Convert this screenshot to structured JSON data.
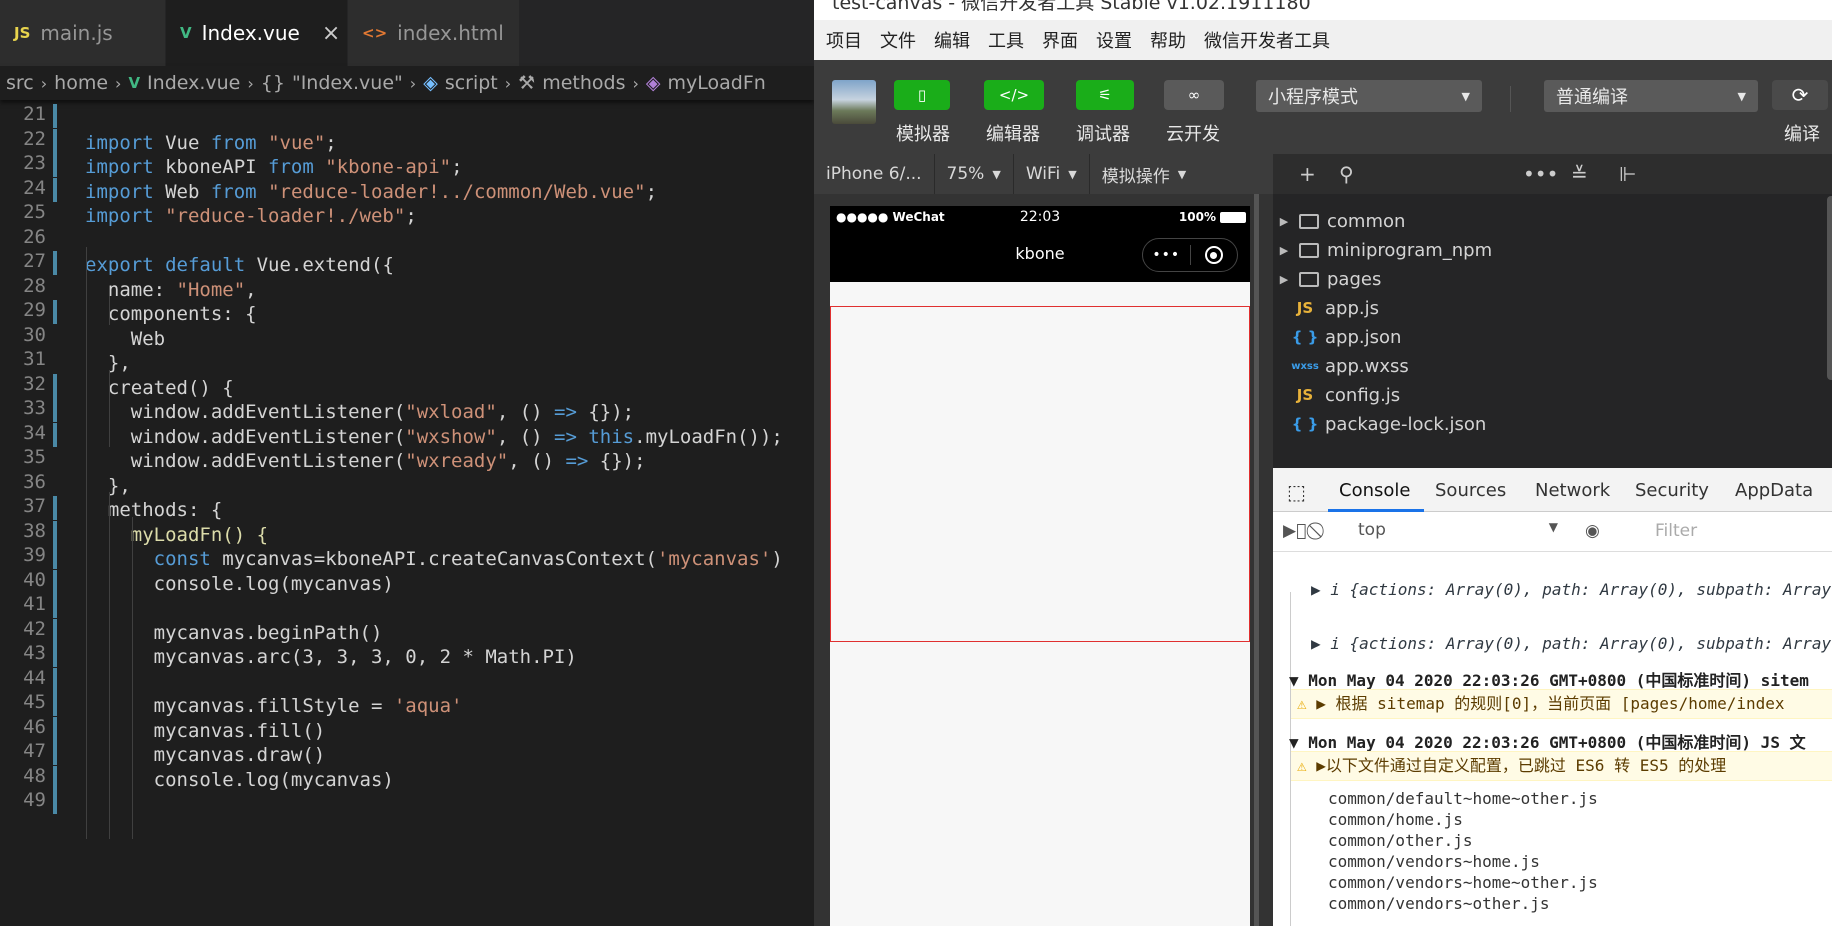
{
  "editor": {
    "tabs": [
      {
        "icon": "JS",
        "label": "main.js"
      },
      {
        "icon": "V",
        "label": "Index.vue",
        "close": "×"
      },
      {
        "icon": "<>",
        "label": "index.html"
      }
    ],
    "breadcrumb": {
      "src": "src",
      "home": "home",
      "file": "Index.vue",
      "obj": "\"Index.vue\"",
      "script": "script",
      "methods": "methods",
      "fn": "myLoadFn"
    },
    "lines": [
      {
        "n": "21"
      },
      {
        "n": "22"
      },
      {
        "n": "23"
      },
      {
        "n": "24"
      },
      {
        "n": "25"
      },
      {
        "n": "26"
      },
      {
        "n": "27"
      },
      {
        "n": "28"
      },
      {
        "n": "29"
      },
      {
        "n": "30"
      },
      {
        "n": "31"
      },
      {
        "n": "32"
      },
      {
        "n": "33"
      },
      {
        "n": "34"
      },
      {
        "n": "35"
      },
      {
        "n": "36"
      },
      {
        "n": "37"
      },
      {
        "n": "38"
      },
      {
        "n": "39"
      },
      {
        "n": "40"
      },
      {
        "n": "41"
      },
      {
        "n": "42"
      },
      {
        "n": "43"
      },
      {
        "n": "44"
      },
      {
        "n": "45"
      },
      {
        "n": "46"
      },
      {
        "n": "47"
      },
      {
        "n": "48"
      },
      {
        "n": "49"
      }
    ],
    "code": {
      "l21": [
        "import",
        " Vue ",
        "from",
        " ",
        "\"vue\"",
        ";"
      ],
      "l22": [
        "import",
        " kboneAPI ",
        "from",
        " ",
        "\"kbone-api\"",
        ";"
      ],
      "l23": [
        "import",
        " Web ",
        "from",
        " ",
        "\"reduce-loader!../common/Web.vue\"",
        ";"
      ],
      "l24": [
        "import",
        " ",
        "\"reduce-loader!./web\"",
        ";"
      ],
      "l26": [
        "export",
        " ",
        "default",
        " Vue.extend({"
      ],
      "l27": [
        "  name: ",
        "\"Home\"",
        ","
      ],
      "l28": [
        "  components: {"
      ],
      "l29": [
        "    Web"
      ],
      "l30": [
        "  },"
      ],
      "l31": [
        "  created() {"
      ],
      "l32": [
        "    window.addEventListener(",
        "\"wxload\"",
        ", () ",
        "=>",
        " {});"
      ],
      "l33": [
        "    window.addEventListener(",
        "\"wxshow\"",
        ", () ",
        "=>",
        " ",
        "this",
        ".myLoadFn());"
      ],
      "l34": [
        "    window.addEventListener(",
        "\"wxready\"",
        ", () ",
        "=>",
        " {});"
      ],
      "l35": [
        "  },"
      ],
      "l36": [
        "  methods: {"
      ],
      "l37": [
        "    myLoadFn() {"
      ],
      "l38": [
        "      ",
        "const",
        " mycanvas=kboneAPI.createCanvasContext(",
        "'mycanvas'",
        ")"
      ],
      "l39": [
        "      console.log(mycanvas)"
      ],
      "l41": [
        "      mycanvas.beginPath()"
      ],
      "l42": [
        "      mycanvas.arc(3, 3, 3, 0, 2 * Math.PI)"
      ],
      "l44": [
        "      mycanvas.fillStyle = ",
        "'aqua'"
      ],
      "l45": [
        "      mycanvas.fill()"
      ],
      "l46": [
        "      mycanvas.draw()"
      ],
      "l47": [
        "      console.log(mycanvas)"
      ]
    }
  },
  "devtools": {
    "title": "test-canvas - 微信开发者工具 Stable v1.02.1911180",
    "menu": [
      "项目",
      "文件",
      "编辑",
      "工具",
      "界面",
      "设置",
      "帮助",
      "微信开发者工具"
    ],
    "toolbar": {
      "simulator": "模拟器",
      "editor": "编辑器",
      "debugger": "调试器",
      "cloud": "云开发",
      "mode": "小程序模式",
      "compile_mode": "普通编译",
      "compile": "编译"
    },
    "devicebar": {
      "device": "iPhone 6/...",
      "zoom": "75%",
      "network": "WiFi",
      "simulate": "模拟操作"
    },
    "phone": {
      "carrier": "●●●●● WeChat",
      "time": "22:03",
      "battery": "100%",
      "nav_title": "kbone",
      "capsule_dots": "•••"
    },
    "filetree": [
      {
        "type": "folder",
        "name": "common"
      },
      {
        "type": "folder",
        "name": "miniprogram_npm"
      },
      {
        "type": "folder",
        "name": "pages"
      },
      {
        "type": "js",
        "icon": "JS",
        "name": "app.js"
      },
      {
        "type": "json",
        "icon": "{ }",
        "name": "app.json"
      },
      {
        "type": "wxss",
        "icon": "wxss",
        "name": "app.wxss"
      },
      {
        "type": "js",
        "icon": "JS",
        "name": "config.js"
      },
      {
        "type": "json",
        "icon": "{ }",
        "name": "package-lock.json"
      }
    ],
    "console_tabs": [
      "Console",
      "Sources",
      "Network",
      "Security",
      "AppData"
    ],
    "console_context": "top",
    "console_filter": "Filter",
    "console_lines": {
      "obj1": "▶ i {actions: Array(0), path: Array(0), subpath: Array",
      "obj2": "▶ i {actions: Array(0), path: Array(0), subpath: Array",
      "hdr1": "▼ Mon May 04 2020 22:03:26 GMT+0800 (中国标准时间) sitem",
      "warn1": " ▶ 根据 sitemap 的规则[0]，当前页面 [pages/home/index",
      "hdr2": "▼ Mon May 04 2020 22:03:26 GMT+0800 (中国标准时间) JS 文",
      "warn2": " ▶以下文件通过自定义配置，已跳过 ES6 转 ES5 的处理",
      "files": [
        "common/default~home~other.js",
        "common/home.js",
        "common/other.js",
        "common/vendors~home.js",
        "common/vendors~home~other.js",
        "common/vendors~other.js"
      ]
    }
  }
}
